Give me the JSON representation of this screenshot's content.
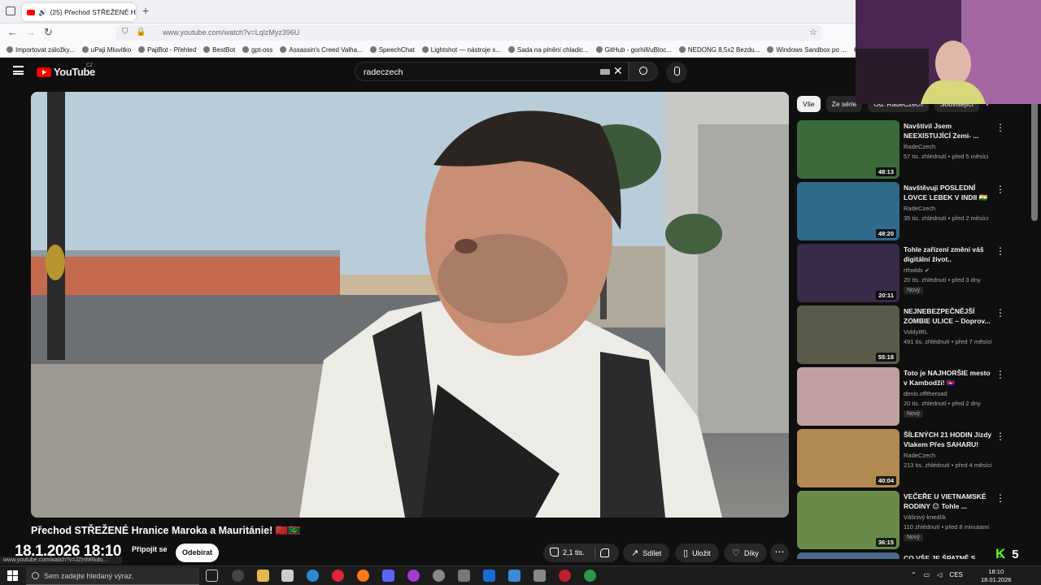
{
  "browser": {
    "tab_title": "(25) Přechod STŘEŽENÉ Hr",
    "url": "www.youtube.com/watch?v=LqlzMyz396U",
    "bookmarks": [
      "Importovat záložky...",
      "uPaji Mluvitko",
      "PajiBot - Přehled",
      "BestBot",
      "gpt-oss",
      "Assassin's Creed Valha...",
      "SpeechChat",
      "Lightshot — nástroje s...",
      "Sada na plnění chladic...",
      "GitHub - gorhill/uBloc...",
      "NEDONG 8,5x2 Bezdu...",
      "Windows Sandbox po ...",
      "ChatGPT - Česky"
    ]
  },
  "youtube": {
    "logo_text": "YouTube",
    "country_code": "CZ",
    "search_value": "radeczech"
  },
  "video": {
    "title": "Přechod STŘEŽENÉ Hranice Maroka a Mauritánie! 🇲🇦🇲🇷",
    "overlay_datetime": "18.1.2026 18:10",
    "join_label": "Připojit se",
    "subscribed_label": "Odebírat",
    "likes": "2,1 tis.",
    "share_label": "Sdílet",
    "save_label": "Uložit",
    "thanks_label": "Díky",
    "status_url": "www.youtube.com/watch?v=JZmhRkdo..."
  },
  "chips": [
    "Vše",
    "Ze série",
    "Od: RadeCzech",
    "Související"
  ],
  "recommended": [
    {
      "title": "Navštívil Jsem NEEXISTUJÍCÍ Zemi- ...",
      "channel": "RadeCzech",
      "meta": "57 tis. zhlédnutí • před 5 měsíci",
      "duration": "48:13",
      "badge": "",
      "color": "#3a6a3a"
    },
    {
      "title": "Navštěvuji POSLEDNÍ LOVCE LEBEK V INDII 🇮🇳",
      "channel": "RadeCzech",
      "meta": "35 tis. zhlédnutí • před 2 měsíci",
      "duration": "48:20",
      "badge": "",
      "color": "#2f6a8a"
    },
    {
      "title": "Tohle zařízení změní váš digitální život..",
      "channel": "rthwlds ✔",
      "meta": "20 tis. zhlédnutí • před 3 dny",
      "duration": "20:11",
      "badge": "Nový",
      "color": "#3a2a4a"
    },
    {
      "title": "NEJNEBEZPEČNĚJŠÍ ZOMBIE ULICE – Doprov...",
      "channel": "VoldyIRL",
      "meta": "491 tis. zhlédnutí • před 7 měsíci",
      "duration": "55:18",
      "badge": "",
      "color": "#5a5a4a"
    },
    {
      "title": "Toto je NAJHORŠIE mesto v Kambodži! 🇰🇭",
      "channel": "denis.offtheroad",
      "meta": "20 tis. zhlédnutí • před 2 dny",
      "duration": "",
      "badge": "Nový",
      "color": "#c0a0a0"
    },
    {
      "title": "ŠÍLENÝCH 21 HODIN Jízdy Vlakem Přes SAHARU! 🇲🇷...",
      "channel": "RadeCzech",
      "meta": "213 tis. zhlédnutí • před 4 měsíci",
      "duration": "40:04",
      "badge": "",
      "color": "#b08a50"
    },
    {
      "title": "VEČEŘE U VIETNAMSKÉ RODINY 😊 Tohle ...",
      "channel": "Vášnivý knedlík",
      "meta": "110 zhlédnutí • před 8 minutami",
      "duration": "36:15",
      "badge": "Nový",
      "color": "#6a8a4a"
    },
    {
      "title": "CO VŠE JE ŠPATNĚ S ...",
      "channel": "",
      "meta": "",
      "duration": "",
      "badge": "",
      "color": "#4a6a8a"
    }
  ],
  "taskbar": {
    "search_placeholder": "Sem zadejte hledaný výraz.",
    "lang": "CES",
    "time": "18:10",
    "date": "18.01.2026"
  },
  "kick": {
    "count": "5"
  }
}
